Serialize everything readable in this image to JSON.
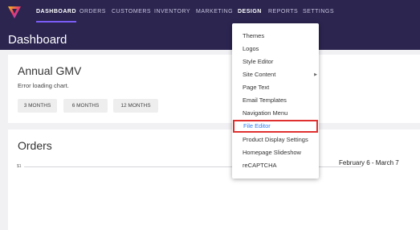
{
  "nav": {
    "items": [
      {
        "label": "DASHBOARD",
        "active": true
      },
      {
        "label": "ORDERS"
      },
      {
        "label": "CUSTOMERS"
      },
      {
        "label": "INVENTORY"
      },
      {
        "label": "MARKETING"
      },
      {
        "label": "DESIGN",
        "open": true
      },
      {
        "label": "REPORTS"
      },
      {
        "label": "SETTINGS"
      }
    ]
  },
  "page": {
    "title": "Dashboard"
  },
  "gmv_card": {
    "title": "Annual GMV",
    "error": "Error loading chart.",
    "ranges": [
      "3 MONTHS",
      "6 MONTHS",
      "12 MONTHS"
    ]
  },
  "orders_card": {
    "title": "Orders",
    "y_tick": "$1",
    "date_range": "February 6 - March 7"
  },
  "design_menu": {
    "items": [
      {
        "label": "Themes"
      },
      {
        "label": "Logos"
      },
      {
        "label": "Style Editor"
      },
      {
        "label": "Site Content",
        "has_submenu": true
      },
      {
        "label": "Page Text"
      },
      {
        "label": "Email Templates"
      },
      {
        "label": "Navigation Menu"
      },
      {
        "label": "File Editor",
        "highlighted": true
      },
      {
        "label": "Product Display Settings"
      },
      {
        "label": "Homepage Slideshow"
      },
      {
        "label": "reCAPTCHA"
      }
    ],
    "highlight_color": "#e03131",
    "link_color": "#2f7df6"
  },
  "colors": {
    "nav_bg": "#2b2550",
    "accent": "#7b5cf5",
    "logo_gradient": [
      "#f5c518",
      "#e8356d",
      "#7b5cf5"
    ]
  }
}
